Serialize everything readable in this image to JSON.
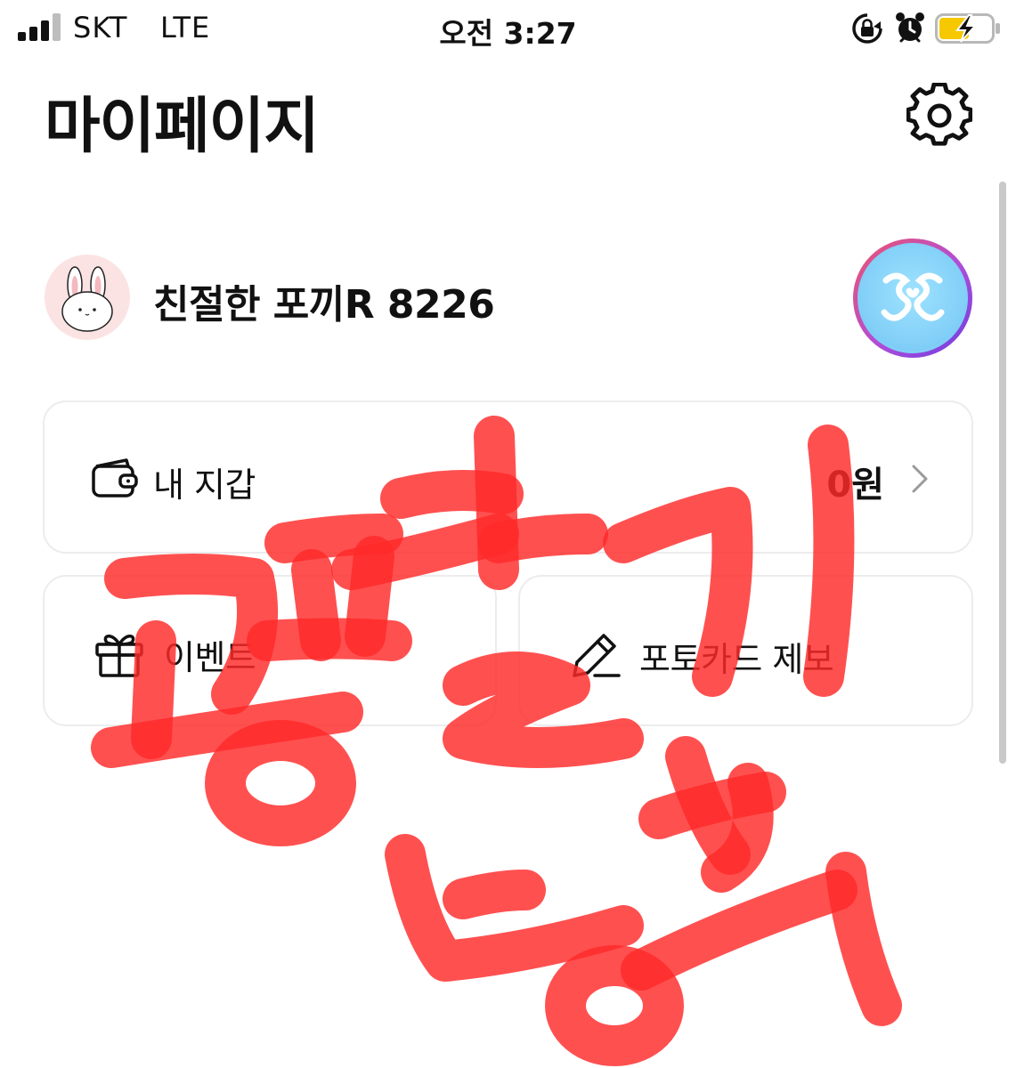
{
  "status_bar": {
    "carrier": "SKT",
    "network": "LTE",
    "time": "오전 3:27"
  },
  "header": {
    "title": "마이페이지",
    "settings_icon": "gear-icon"
  },
  "profile": {
    "nickname": "친절한 포끼R 8226",
    "avatar_icon": "bunny-avatar",
    "badge_icon": "membership-badge"
  },
  "menu": {
    "wallet": {
      "label": "내 지갑",
      "amount": "0원",
      "icon": "wallet-icon"
    },
    "event": {
      "label": "이벤트",
      "icon": "gift-icon"
    },
    "photocard_report": {
      "label": "포토카드 제보",
      "icon": "pencil-icon"
    }
  },
  "colors": {
    "scribble": "#ff2a2a",
    "badge_ring": "#b04dd8",
    "badge_fill": "#8fd6fb",
    "avatar_bg": "#fbe3e3",
    "card_border": "#ececec"
  }
}
